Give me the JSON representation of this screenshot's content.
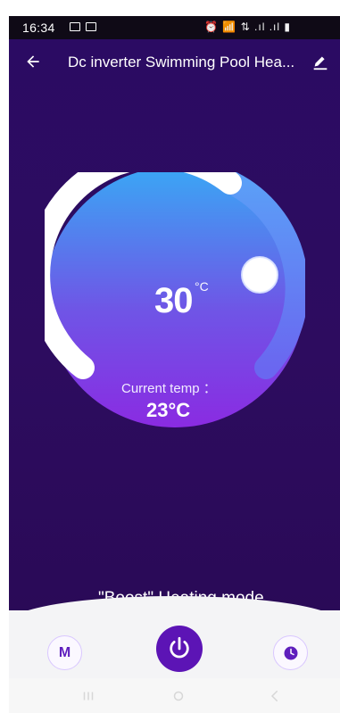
{
  "status": {
    "time": "16:34",
    "right_icons_text": "⏰ 📶 ⇅ .ıl .ıl ▮"
  },
  "header": {
    "title": "Dc inverter Swimming Pool Hea...",
    "back_icon": "arrow-left-icon",
    "edit_icon": "pencil-edit-icon"
  },
  "thermostat": {
    "set_temp": "30",
    "set_unit": "°C",
    "current_label": "Current temp ：",
    "current_temp": "23°C",
    "level_fraction": 0.82
  },
  "mode": {
    "text": "\"Boost\" Heating mode"
  },
  "bottom_controls": {
    "left_button_label": "M",
    "power_icon": "power-icon",
    "timer_icon": "clock-icon"
  },
  "colors": {
    "app_bg": "#2b0b63",
    "power_bg": "#5c14b5",
    "accent": "#5f1fbd"
  }
}
